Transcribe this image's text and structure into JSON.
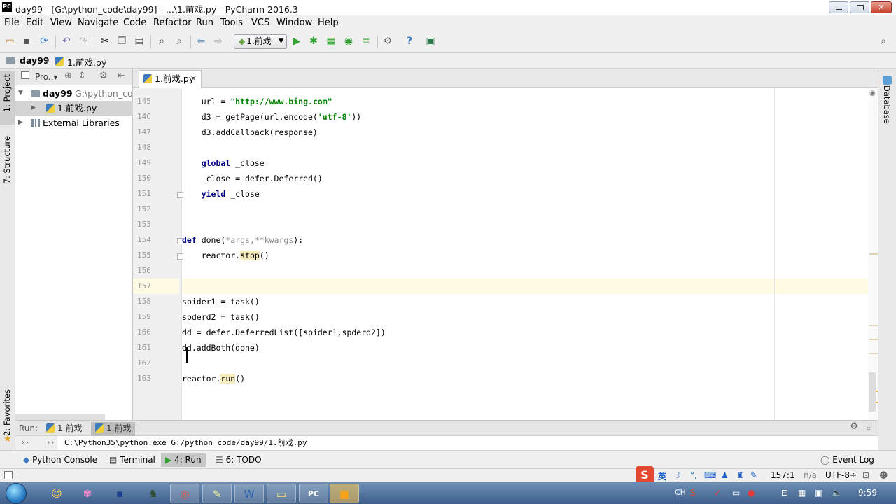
{
  "window": {
    "title": "day99 - [G:\\python_code\\day99] - ...\\1.前戏.py - PyCharm 2016.3",
    "app_icon": "PC"
  },
  "menu": [
    "File",
    "Edit",
    "View",
    "Navigate",
    "Code",
    "Refactor",
    "Run",
    "Tools",
    "VCS",
    "Window",
    "Help"
  ],
  "toolbar": {
    "run_config": "1.前戏"
  },
  "breadcrumb": {
    "project": "day99",
    "file": "1.前戏.py"
  },
  "left_tabs": {
    "project": "1: Project",
    "structure": "7: Structure",
    "favorites": "2: Favorites"
  },
  "right_tabs": {
    "database": "Database"
  },
  "project_panel": {
    "header": "Pro..▾",
    "root_name": "day99",
    "root_path": "G:\\python_cod",
    "file": "1.前戏.py",
    "libraries": "External Libraries"
  },
  "editor": {
    "tab": "1.前戏.py",
    "line_numbers": [
      "145",
      "146",
      "147",
      "148",
      "149",
      "150",
      "151",
      "152",
      "153",
      "154",
      "155",
      "156",
      "157",
      "158",
      "159",
      "160",
      "161",
      "162",
      "163"
    ],
    "code": {
      "l145_a": "    url = ",
      "l145_b": "\"http://www.bing.com\"",
      "l146_a": "    d3 = getPage(url.encode(",
      "l146_b": "'utf-8'",
      "l146_c": "))",
      "l147": "    d3.addCallback(response)",
      "l149_kw": "global",
      "l149_b": " _close",
      "l150": "    _close = defer.Deferred()",
      "l151_kw": "yield",
      "l151_b": " _close",
      "l154_kw": "def",
      "l154_b": " done(",
      "l154_c": "*args,**kwargs",
      "l154_d": "):",
      "l155_a": "    reactor.",
      "l155_b": "stop",
      "l155_c": "()",
      "l158": "spider1 = task()",
      "l159": "spderd2 = task()",
      "l160": "dd = defer.DeferredList([spider1,spderd2])",
      "l161": "dd.addBoth(done)",
      "l163_a": "reactor.",
      "l163_b": "run",
      "l163_c": "()"
    }
  },
  "run_panel": {
    "label": "Run:",
    "tabs": [
      "1.前戏",
      "1.前戏"
    ],
    "output": "C:\\Python35\\python.exe G:/python_code/day99/1.前戏.py"
  },
  "tool_windows": [
    "Python Console",
    "Terminal",
    "4: Run",
    "6: TODO",
    "Event Log"
  ],
  "status": {
    "ime": "英",
    "position": "157:1",
    "na": "n/a",
    "encoding": "UTF-8÷"
  },
  "taskbar": {
    "lang": "CH",
    "time": "9:59"
  }
}
